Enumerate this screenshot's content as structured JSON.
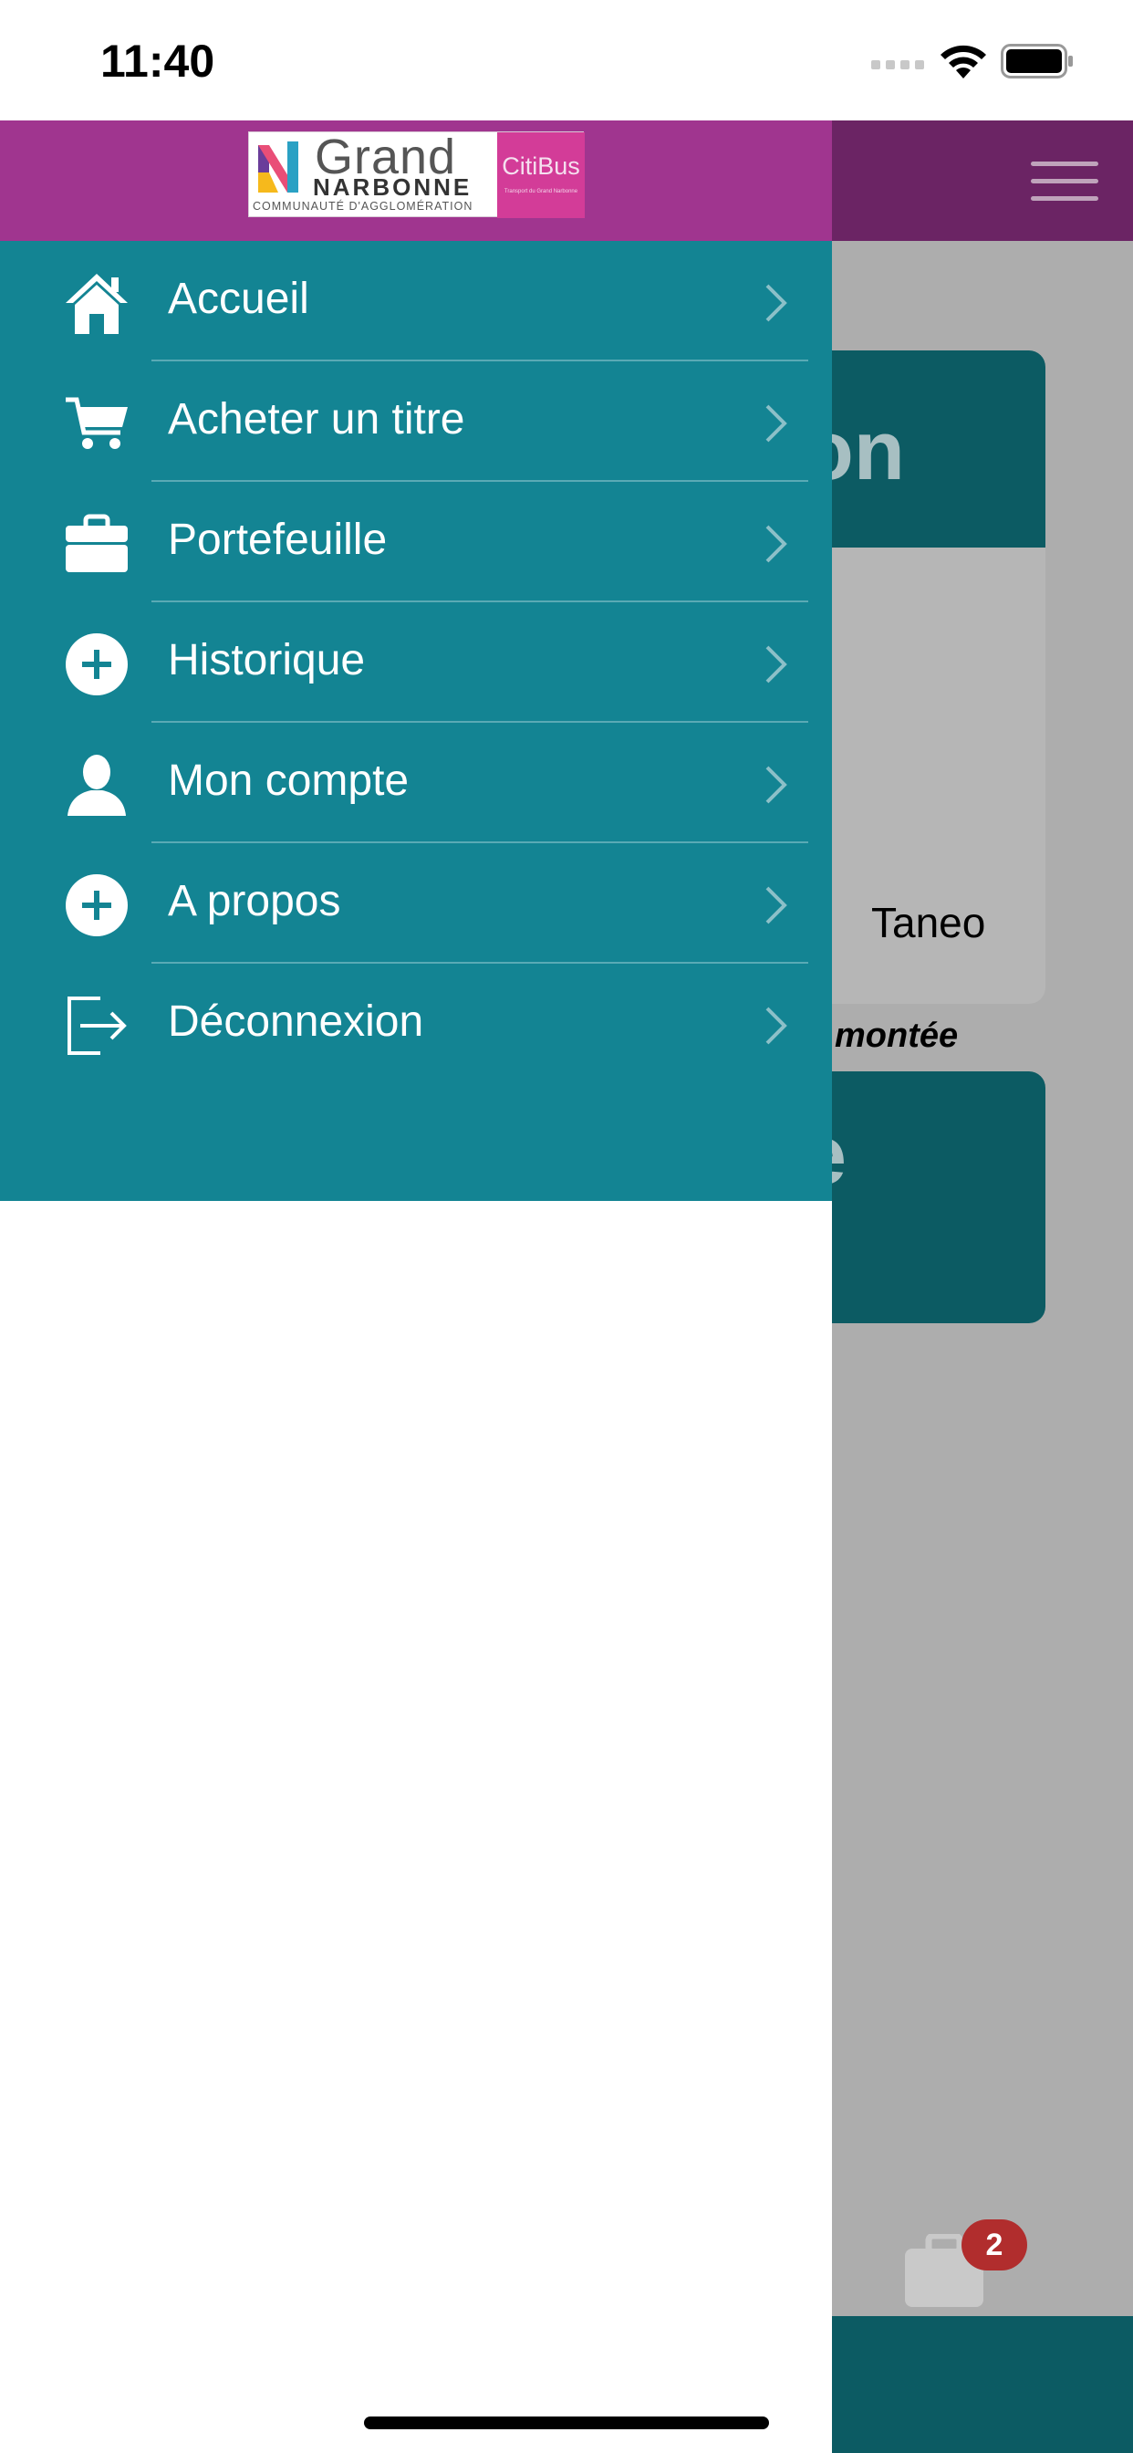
{
  "status_bar": {
    "time": "11:40"
  },
  "drawer": {
    "logo": {
      "brand_line1": "Grand",
      "brand_line2": "NARBONNE",
      "brand_line3": "COMMUNAUTÉ D'AGGLOMÉRATION",
      "partner": "CitiBus",
      "partner_sub": "Transport du Grand Narbonne"
    },
    "menu": [
      {
        "label": "Accueil",
        "icon": "home-icon"
      },
      {
        "label": "Acheter un titre",
        "icon": "cart-icon"
      },
      {
        "label": "Portefeuille",
        "icon": "briefcase-icon"
      },
      {
        "label": "Historique",
        "icon": "plus-circle-icon"
      },
      {
        "label": "Mon compte",
        "icon": "user-icon"
      },
      {
        "label": "A propos",
        "icon": "plus-circle-icon"
      },
      {
        "label": "Déconnexion",
        "icon": "logout-icon"
      }
    ]
  },
  "background": {
    "card1_title_fragment": "on",
    "card1_value": "Taneo",
    "card1_emphasis": "montée",
    "card2_title_fragment": "e",
    "wallet_badge_count": "2"
  },
  "colors": {
    "header_purple": "#a0358f",
    "menu_teal": "#138493",
    "badge_red": "#b12d2d"
  }
}
